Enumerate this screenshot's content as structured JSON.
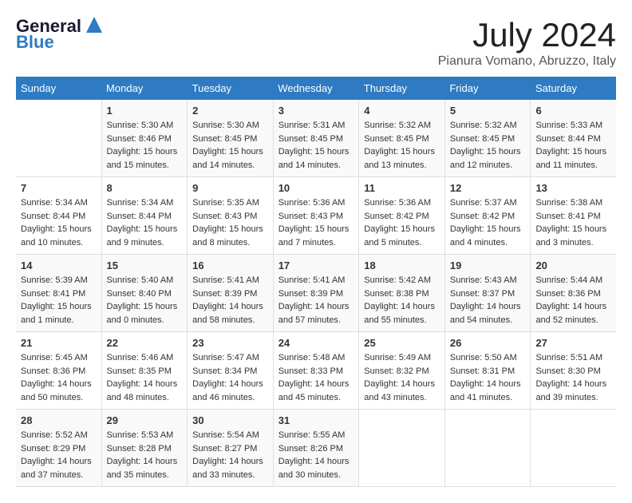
{
  "header": {
    "logo_line1": "General",
    "logo_line2": "Blue",
    "month_year": "July 2024",
    "location": "Pianura Vomano, Abruzzo, Italy"
  },
  "days_of_week": [
    "Sunday",
    "Monday",
    "Tuesday",
    "Wednesday",
    "Thursday",
    "Friday",
    "Saturday"
  ],
  "weeks": [
    [
      {
        "day": "",
        "info": ""
      },
      {
        "day": "1",
        "info": "Sunrise: 5:30 AM\nSunset: 8:46 PM\nDaylight: 15 hours\nand 15 minutes."
      },
      {
        "day": "2",
        "info": "Sunrise: 5:30 AM\nSunset: 8:45 PM\nDaylight: 15 hours\nand 14 minutes."
      },
      {
        "day": "3",
        "info": "Sunrise: 5:31 AM\nSunset: 8:45 PM\nDaylight: 15 hours\nand 14 minutes."
      },
      {
        "day": "4",
        "info": "Sunrise: 5:32 AM\nSunset: 8:45 PM\nDaylight: 15 hours\nand 13 minutes."
      },
      {
        "day": "5",
        "info": "Sunrise: 5:32 AM\nSunset: 8:45 PM\nDaylight: 15 hours\nand 12 minutes."
      },
      {
        "day": "6",
        "info": "Sunrise: 5:33 AM\nSunset: 8:44 PM\nDaylight: 15 hours\nand 11 minutes."
      }
    ],
    [
      {
        "day": "7",
        "info": "Sunrise: 5:34 AM\nSunset: 8:44 PM\nDaylight: 15 hours\nand 10 minutes."
      },
      {
        "day": "8",
        "info": "Sunrise: 5:34 AM\nSunset: 8:44 PM\nDaylight: 15 hours\nand 9 minutes."
      },
      {
        "day": "9",
        "info": "Sunrise: 5:35 AM\nSunset: 8:43 PM\nDaylight: 15 hours\nand 8 minutes."
      },
      {
        "day": "10",
        "info": "Sunrise: 5:36 AM\nSunset: 8:43 PM\nDaylight: 15 hours\nand 7 minutes."
      },
      {
        "day": "11",
        "info": "Sunrise: 5:36 AM\nSunset: 8:42 PM\nDaylight: 15 hours\nand 5 minutes."
      },
      {
        "day": "12",
        "info": "Sunrise: 5:37 AM\nSunset: 8:42 PM\nDaylight: 15 hours\nand 4 minutes."
      },
      {
        "day": "13",
        "info": "Sunrise: 5:38 AM\nSunset: 8:41 PM\nDaylight: 15 hours\nand 3 minutes."
      }
    ],
    [
      {
        "day": "14",
        "info": "Sunrise: 5:39 AM\nSunset: 8:41 PM\nDaylight: 15 hours\nand 1 minute."
      },
      {
        "day": "15",
        "info": "Sunrise: 5:40 AM\nSunset: 8:40 PM\nDaylight: 15 hours\nand 0 minutes."
      },
      {
        "day": "16",
        "info": "Sunrise: 5:41 AM\nSunset: 8:39 PM\nDaylight: 14 hours\nand 58 minutes."
      },
      {
        "day": "17",
        "info": "Sunrise: 5:41 AM\nSunset: 8:39 PM\nDaylight: 14 hours\nand 57 minutes."
      },
      {
        "day": "18",
        "info": "Sunrise: 5:42 AM\nSunset: 8:38 PM\nDaylight: 14 hours\nand 55 minutes."
      },
      {
        "day": "19",
        "info": "Sunrise: 5:43 AM\nSunset: 8:37 PM\nDaylight: 14 hours\nand 54 minutes."
      },
      {
        "day": "20",
        "info": "Sunrise: 5:44 AM\nSunset: 8:36 PM\nDaylight: 14 hours\nand 52 minutes."
      }
    ],
    [
      {
        "day": "21",
        "info": "Sunrise: 5:45 AM\nSunset: 8:36 PM\nDaylight: 14 hours\nand 50 minutes."
      },
      {
        "day": "22",
        "info": "Sunrise: 5:46 AM\nSunset: 8:35 PM\nDaylight: 14 hours\nand 48 minutes."
      },
      {
        "day": "23",
        "info": "Sunrise: 5:47 AM\nSunset: 8:34 PM\nDaylight: 14 hours\nand 46 minutes."
      },
      {
        "day": "24",
        "info": "Sunrise: 5:48 AM\nSunset: 8:33 PM\nDaylight: 14 hours\nand 45 minutes."
      },
      {
        "day": "25",
        "info": "Sunrise: 5:49 AM\nSunset: 8:32 PM\nDaylight: 14 hours\nand 43 minutes."
      },
      {
        "day": "26",
        "info": "Sunrise: 5:50 AM\nSunset: 8:31 PM\nDaylight: 14 hours\nand 41 minutes."
      },
      {
        "day": "27",
        "info": "Sunrise: 5:51 AM\nSunset: 8:30 PM\nDaylight: 14 hours\nand 39 minutes."
      }
    ],
    [
      {
        "day": "28",
        "info": "Sunrise: 5:52 AM\nSunset: 8:29 PM\nDaylight: 14 hours\nand 37 minutes."
      },
      {
        "day": "29",
        "info": "Sunrise: 5:53 AM\nSunset: 8:28 PM\nDaylight: 14 hours\nand 35 minutes."
      },
      {
        "day": "30",
        "info": "Sunrise: 5:54 AM\nSunset: 8:27 PM\nDaylight: 14 hours\nand 33 minutes."
      },
      {
        "day": "31",
        "info": "Sunrise: 5:55 AM\nSunset: 8:26 PM\nDaylight: 14 hours\nand 30 minutes."
      },
      {
        "day": "",
        "info": ""
      },
      {
        "day": "",
        "info": ""
      },
      {
        "day": "",
        "info": ""
      }
    ]
  ]
}
